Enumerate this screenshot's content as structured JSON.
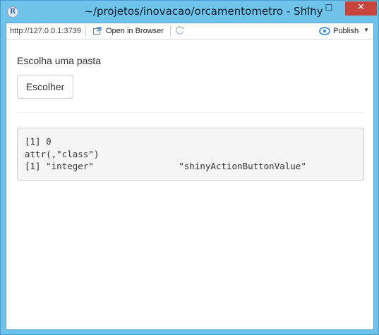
{
  "window": {
    "title": "~/projetos/inovacao/orcamentometro - Shiny",
    "icon_letter": "R",
    "controls": {
      "minimize": "—",
      "maximize": "☐",
      "close": "✕"
    }
  },
  "toolbar": {
    "url": "http://127.0.0.1:3739",
    "open_in_browser": "Open in Browser",
    "publish": "Publish",
    "publish_caret": "▼"
  },
  "page": {
    "prompt_label": "Escolha uma pasta",
    "choose_button": "Escolher",
    "output_lines": [
      "[1] 0",
      "attr(,\"class\")",
      "[1] \"integer\"                \"shinyActionButtonValue\""
    ]
  },
  "colors": {
    "titlebar": "#6ec3ea",
    "close_button": "#c7453a",
    "publish_icon": "#4a90c8"
  }
}
